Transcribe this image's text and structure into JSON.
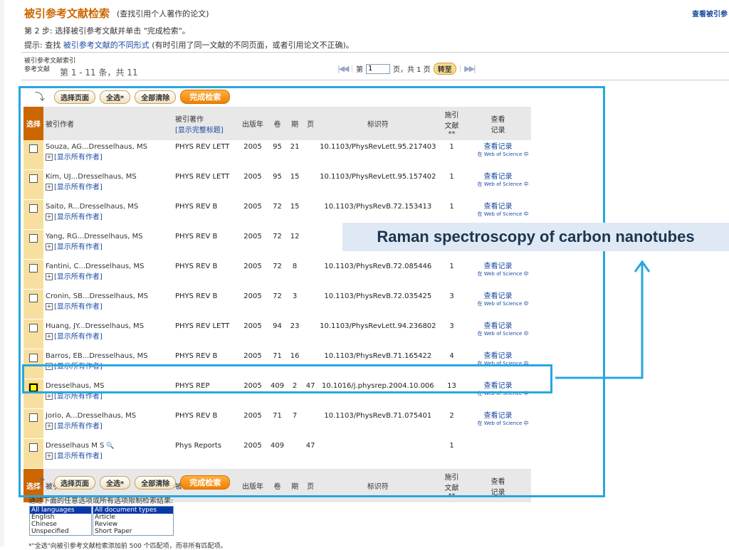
{
  "header": {
    "title": "被引参考文献检索",
    "subtitle": "(查找引用个人著作的论文)",
    "top_right_link": "查看被引参",
    "step": "第 2 步: 选择被引参考文献并单击 \"完成检索\"。",
    "tip_prefix": "提示: 查找",
    "tip_link": "被引参考文献的不同形式",
    "tip_suffix": "(有时引用了同一文献的不同页面，或者引用论文不正确)。"
  },
  "index": {
    "label_line1": "被引参考文献索引",
    "label_line2": "参考文献",
    "range": "第 1 - 11 条，共  11"
  },
  "pager": {
    "prefix": "第",
    "page_value": "1",
    "suffix": "页，共 1 页",
    "go": "转至"
  },
  "buttons": {
    "select_page": "选择页面",
    "select_all": "全选*",
    "clear_all": "全部清除",
    "finish": "完成检索"
  },
  "columns": {
    "select": "选择",
    "author": "被引作者",
    "work": "被引著作",
    "work_sub": "[显示完整标题]",
    "year": "出版年",
    "volume": "卷",
    "issue": "期",
    "page": "页",
    "identifier": "标识符",
    "citing_line1": "施引",
    "citing_line2": "文献 **",
    "view_line1": "查看",
    "view_line2": "记录"
  },
  "show_all_authors": "[显示所有作者]",
  "view_record": "查看记录",
  "view_record_sub": "在 Web of Science 中",
  "rows": [
    {
      "author": "Souza, AG...Dresselhaus, MS",
      "work": "PHYS REV LETT",
      "year": "2005",
      "vol": "95",
      "issue": "21",
      "page": "",
      "id": "10.1103/PhysRevLett.95.217403",
      "cites": "1",
      "checked": false,
      "view": true
    },
    {
      "author": "Kim, UJ...Dresselhaus, MS",
      "work": "PHYS REV LETT",
      "year": "2005",
      "vol": "95",
      "issue": "15",
      "page": "",
      "id": "10.1103/PhysRevLett.95.157402",
      "cites": "1",
      "checked": false,
      "view": true
    },
    {
      "author": "Saito, R...Dresselhaus, MS",
      "work": "PHYS REV B",
      "year": "2005",
      "vol": "72",
      "issue": "15",
      "page": "",
      "id": "10.1103/PhysRevB.72.153413",
      "cites": "1",
      "checked": false,
      "view": true
    },
    {
      "author": "Yang, RG...Dresselhaus, MS",
      "work": "PHYS REV B",
      "year": "2005",
      "vol": "72",
      "issue": "12",
      "page": "",
      "id": "",
      "cites": "",
      "checked": false,
      "view": false
    },
    {
      "author": "Fantini, C...Dresselhaus, MS",
      "work": "PHYS REV B",
      "year": "2005",
      "vol": "72",
      "issue": "8",
      "page": "",
      "id": "10.1103/PhysRevB.72.085446",
      "cites": "1",
      "checked": false,
      "view": true
    },
    {
      "author": "Cronin, SB...Dresselhaus, MS",
      "work": "PHYS REV B",
      "year": "2005",
      "vol": "72",
      "issue": "3",
      "page": "",
      "id": "10.1103/PhysRevB.72.035425",
      "cites": "3",
      "checked": false,
      "view": true
    },
    {
      "author": "Huang, JY...Dresselhaus, MS",
      "work": "PHYS REV LETT",
      "year": "2005",
      "vol": "94",
      "issue": "23",
      "page": "",
      "id": "10.1103/PhysRevLett.94.236802",
      "cites": "3",
      "checked": false,
      "view": true
    },
    {
      "author": "Barros, EB...Dresselhaus, MS",
      "work": "PHYS REV B",
      "year": "2005",
      "vol": "71",
      "issue": "16",
      "page": "",
      "id": "10.1103/PhysRevB.71.165422",
      "cites": "4",
      "checked": false,
      "view": true
    },
    {
      "author": "Dresselhaus, MS",
      "work": "PHYS REP",
      "year": "2005",
      "vol": "409",
      "issue": "2",
      "page": "47",
      "id": "10.1016/j.physrep.2004.10.006",
      "cites": "13",
      "checked": true,
      "view": true
    },
    {
      "author": "Jorio, A...Dresselhaus, MS",
      "work": "PHYS REV B",
      "year": "2005",
      "vol": "71",
      "issue": "7",
      "page": "",
      "id": "10.1103/PhysRevB.71.075401",
      "cites": "2",
      "checked": false,
      "view": true
    },
    {
      "author": "Dresselhaus M S",
      "work": "Phys Reports",
      "year": "2005",
      "vol": "409",
      "issue": "",
      "page": "47",
      "id": "",
      "cites": "1",
      "checked": false,
      "view": false,
      "magnifier": true
    }
  ],
  "callout": "Raman spectroscopy of carbon nanotubes",
  "filter": {
    "text": "通过下面的任意选项或所有选项限制检索结果:",
    "languages": [
      "All languages",
      "English",
      "Chinese",
      "Unspecified"
    ],
    "doc_types": [
      "All document types",
      "Article",
      "Review",
      "Short Paper"
    ]
  },
  "footnote": "*\"全选\"向被引参考文献检索添加前 500 个匹配项，而非所有匹配项。",
  "colors": {
    "accent": "#cc6600",
    "highlight": "#27a7df",
    "link": "#1a4aa0"
  }
}
